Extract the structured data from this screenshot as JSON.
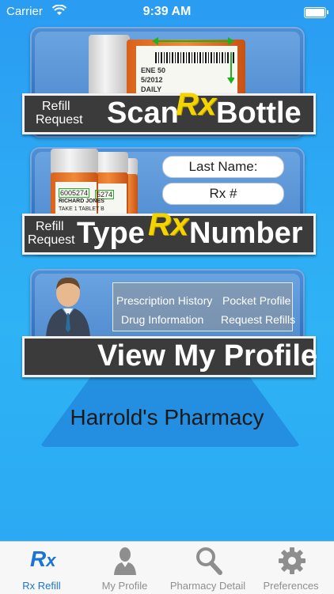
{
  "status_bar": {
    "carrier": "Carrier",
    "time": "9:39 AM"
  },
  "cards": {
    "scan": {
      "small_label_1": "Refill",
      "small_label_2": "Request",
      "word_left": "Scan",
      "rx": "Rx",
      "word_right": "Bottle",
      "bottle_label_lines": [
        "ENE 50",
        "5/2012",
        "DAILY"
      ]
    },
    "type": {
      "small_label_1": "Refill",
      "small_label_2": "Request",
      "word_left": "Type",
      "rx": "Rx",
      "word_right": "Number",
      "last_name_placeholder": "Last Name:",
      "rx_placeholder": "Rx #",
      "bottle_numbers": [
        "6005274",
        "5274"
      ],
      "bottle_name": "RICHARD JONES",
      "bottle_directions": "TAKE 1 TABLET B"
    },
    "profile": {
      "title": "View My Profile",
      "links": [
        "Prescription History",
        "Pocket Profile",
        "Drug Information",
        "Request Refills"
      ]
    }
  },
  "pharmacy_name": "Harrold's Pharmacy",
  "tabs": [
    {
      "label": "Rx Refill",
      "icon": "rx-icon",
      "active": true
    },
    {
      "label": "My Profile",
      "icon": "person-icon",
      "active": false
    },
    {
      "label": "Pharmacy Detail",
      "icon": "search-icon",
      "active": false
    },
    {
      "label": "Preferences",
      "icon": "gear-icon",
      "active": false
    }
  ],
  "colors": {
    "accent": "#1a73d6",
    "background": "#2fb3f5",
    "rx_yellow": "#f3d400"
  }
}
